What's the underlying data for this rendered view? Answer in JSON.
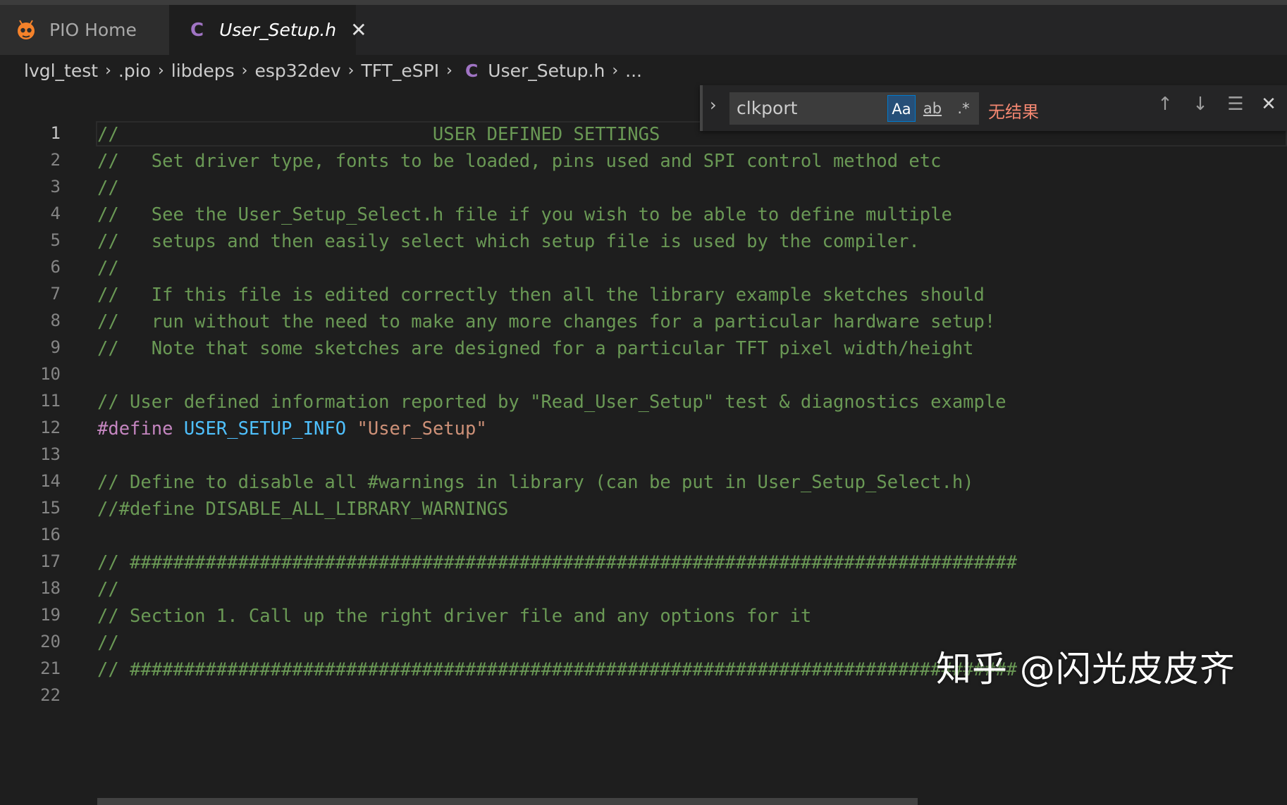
{
  "tabs": [
    {
      "label": "PIO Home",
      "icon": "platformio-alien-icon",
      "active": false
    },
    {
      "label": "User_Setup.h",
      "icon": "c-language-icon",
      "type_letter": "C",
      "active": true,
      "close": "✕"
    }
  ],
  "breadcrumb": {
    "items": [
      "lvgl_test",
      ".pio",
      "libdeps",
      "esp32dev",
      "TFT_eSPI"
    ],
    "file_letter": "C",
    "file": "User_Setup.h",
    "more": "...",
    "separator": "›"
  },
  "find": {
    "value": "clkport",
    "options": {
      "match_case": "Aa",
      "whole_word": "ab",
      "regex": ".*"
    },
    "result": "无结果"
  },
  "lines": [
    {
      "n": "1",
      "segs": [
        {
          "t": "//                             USER DEFINED SETTINGS",
          "c": "cm"
        }
      ]
    },
    {
      "n": "2",
      "segs": [
        {
          "t": "//   Set driver type, fonts to be loaded, pins used and SPI control method etc",
          "c": "cm"
        }
      ]
    },
    {
      "n": "3",
      "segs": [
        {
          "t": "//",
          "c": "cm"
        }
      ]
    },
    {
      "n": "4",
      "segs": [
        {
          "t": "//   See the User_Setup_Select.h file if you wish to be able to define multiple",
          "c": "cm"
        }
      ]
    },
    {
      "n": "5",
      "segs": [
        {
          "t": "//   setups and then easily select which setup file is used by the compiler.",
          "c": "cm"
        }
      ]
    },
    {
      "n": "6",
      "segs": [
        {
          "t": "//",
          "c": "cm"
        }
      ]
    },
    {
      "n": "7",
      "segs": [
        {
          "t": "//   If this file is edited correctly then all the library example sketches should",
          "c": "cm"
        }
      ]
    },
    {
      "n": "8",
      "segs": [
        {
          "t": "//   run without the need to make any more changes for a particular hardware setup!",
          "c": "cm"
        }
      ]
    },
    {
      "n": "9",
      "segs": [
        {
          "t": "//   Note that some sketches are designed for a particular TFT pixel width/height",
          "c": "cm"
        }
      ]
    },
    {
      "n": "10",
      "segs": []
    },
    {
      "n": "11",
      "segs": [
        {
          "t": "// User defined information reported by \"Read_User_Setup\" test & diagnostics example",
          "c": "cm"
        }
      ]
    },
    {
      "n": "12",
      "segs": [
        {
          "t": "#define",
          "c": "kw"
        },
        {
          "t": " ",
          "c": "plain"
        },
        {
          "t": "USER_SETUP_INFO",
          "c": "mac"
        },
        {
          "t": " ",
          "c": "plain"
        },
        {
          "t": "\"User_Setup\"",
          "c": "str"
        }
      ]
    },
    {
      "n": "13",
      "segs": []
    },
    {
      "n": "14",
      "segs": [
        {
          "t": "// Define to disable all #warnings in library (can be put in User_Setup_Select.h)",
          "c": "cm"
        }
      ]
    },
    {
      "n": "15",
      "segs": [
        {
          "t": "//#define DISABLE_ALL_LIBRARY_WARNINGS",
          "c": "cm"
        }
      ]
    },
    {
      "n": "16",
      "segs": []
    },
    {
      "n": "17",
      "segs": [
        {
          "t": "// ##################################################################################",
          "c": "cm"
        }
      ]
    },
    {
      "n": "18",
      "segs": [
        {
          "t": "//",
          "c": "cm"
        }
      ]
    },
    {
      "n": "19",
      "segs": [
        {
          "t": "// Section 1. Call up the right driver file and any options for it",
          "c": "cm"
        }
      ]
    },
    {
      "n": "20",
      "segs": [
        {
          "t": "//",
          "c": "cm"
        }
      ]
    },
    {
      "n": "21",
      "segs": [
        {
          "t": "// ##################################################################################",
          "c": "cm"
        }
      ]
    },
    {
      "n": "22",
      "segs": []
    }
  ],
  "watermark": "知乎 @闪光皮皮齐",
  "colors": {
    "comment": "#6a9955",
    "keyword": "#c586c0",
    "macro": "#4fc1ff",
    "string": "#ce9178",
    "no_result": "#f48771",
    "editor_bg": "#1e1e1e"
  }
}
